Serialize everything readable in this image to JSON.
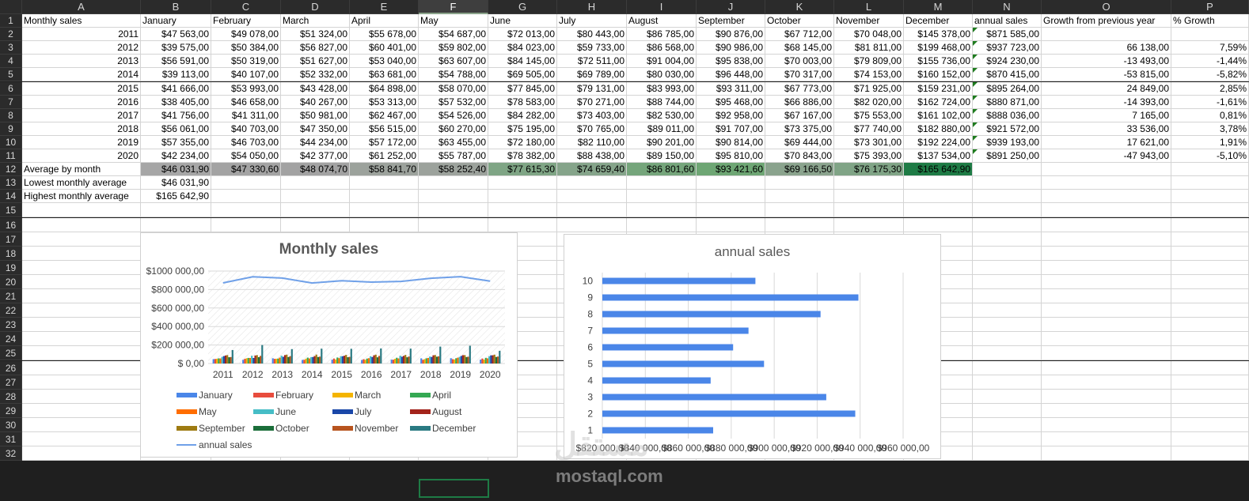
{
  "columns": [
    "A",
    "B",
    "C",
    "D",
    "E",
    "F",
    "G",
    "H",
    "I",
    "J",
    "K",
    "L",
    "M",
    "N",
    "O",
    "P"
  ],
  "selected_column": "F",
  "rows": [
    "1",
    "2",
    "3",
    "4",
    "5",
    "6",
    "7",
    "8",
    "9",
    "10",
    "11",
    "12",
    "13",
    "14",
    "15",
    "16",
    "17",
    "18",
    "19",
    "20",
    "21",
    "22",
    "23",
    "24",
    "25",
    "26",
    "27",
    "28",
    "29",
    "30",
    "31",
    "32"
  ],
  "header_row": [
    "Monthly sales",
    "January",
    "February",
    "March",
    "April",
    "May",
    "June",
    "July",
    "August",
    "September",
    "October",
    "November",
    "December",
    "annual sales",
    "Growth from previous year",
    "% Growth"
  ],
  "data_rows": [
    [
      "2011",
      "$47 563,00",
      "$49 078,00",
      "$51 324,00",
      "$55 678,00",
      "$54 687,00",
      "$72 013,00",
      "$80 443,00",
      "$86 785,00",
      "$90 876,00",
      "$67 712,00",
      "$70 048,00",
      "$145 378,00",
      "$871 585,00",
      "",
      ""
    ],
    [
      "2012",
      "$39 575,00",
      "$50 384,00",
      "$56 827,00",
      "$60 401,00",
      "$59 802,00",
      "$84 023,00",
      "$59 733,00",
      "$86 568,00",
      "$90 986,00",
      "$68 145,00",
      "$81 811,00",
      "$199 468,00",
      "$937 723,00",
      "66 138,00",
      "7,59%"
    ],
    [
      "2013",
      "$56 591,00",
      "$50 319,00",
      "$51 627,00",
      "$53 040,00",
      "$63 607,00",
      "$84 145,00",
      "$72 511,00",
      "$91 004,00",
      "$95 838,00",
      "$70 003,00",
      "$79 809,00",
      "$155 736,00",
      "$924 230,00",
      "-13 493,00",
      "-1,44%"
    ],
    [
      "2014",
      "$39 113,00",
      "$40 107,00",
      "$52 332,00",
      "$63 681,00",
      "$54 788,00",
      "$69 505,00",
      "$69 789,00",
      "$80 030,00",
      "$96 448,00",
      "$70 317,00",
      "$74 153,00",
      "$160 152,00",
      "$870 415,00",
      "-53 815,00",
      "-5,82%"
    ],
    [
      "2015",
      "$41 666,00",
      "$53 993,00",
      "$43 428,00",
      "$64 898,00",
      "$58 070,00",
      "$77 845,00",
      "$79 131,00",
      "$83 993,00",
      "$93 311,00",
      "$67 773,00",
      "$71 925,00",
      "$159 231,00",
      "$895 264,00",
      "24 849,00",
      "2,85%"
    ],
    [
      "2016",
      "$38 405,00",
      "$46 658,00",
      "$40 267,00",
      "$53 313,00",
      "$57 532,00",
      "$78 583,00",
      "$70 271,00",
      "$88 744,00",
      "$95 468,00",
      "$66 886,00",
      "$82 020,00",
      "$162 724,00",
      "$880 871,00",
      "-14 393,00",
      "-1,61%"
    ],
    [
      "2017",
      "$41 756,00",
      "$41 311,00",
      "$50 981,00",
      "$62 467,00",
      "$54 526,00",
      "$84 282,00",
      "$73 403,00",
      "$82 530,00",
      "$92 958,00",
      "$67 167,00",
      "$75 553,00",
      "$161 102,00",
      "$888 036,00",
      "7 165,00",
      "0,81%"
    ],
    [
      "2018",
      "$56 061,00",
      "$40 703,00",
      "$47 350,00",
      "$56 515,00",
      "$60 270,00",
      "$75 195,00",
      "$70 765,00",
      "$89 011,00",
      "$91 707,00",
      "$73 375,00",
      "$77 740,00",
      "$182 880,00",
      "$921 572,00",
      "33 536,00",
      "3,78%"
    ],
    [
      "2019",
      "$57 355,00",
      "$46 703,00",
      "$44 234,00",
      "$57 172,00",
      "$63 455,00",
      "$72 180,00",
      "$82 110,00",
      "$90 201,00",
      "$90 814,00",
      "$69 444,00",
      "$73 301,00",
      "$192 224,00",
      "$939 193,00",
      "17 621,00",
      "1,91%"
    ],
    [
      "2020",
      "$42 234,00",
      "$54 050,00",
      "$42 377,00",
      "$61 252,00",
      "$55 787,00",
      "$78 382,00",
      "$88 438,00",
      "$89 150,00",
      "$95 810,00",
      "$70 843,00",
      "$75 393,00",
      "$137 534,00",
      "$891 250,00",
      "-47 943,00",
      "-5,10%"
    ]
  ],
  "average_row": {
    "label": "Average by month",
    "values": [
      "$46 031,90",
      "$47 330,60",
      "$48 074,70",
      "$58 841,70",
      "$58 252,40",
      "$77 615,30",
      "$74 659,40",
      "$86 801,60",
      "$93 421,60",
      "$69 166,50",
      "$76 175,30",
      "$165 642,90"
    ],
    "fill_colors": [
      "#a6a6a6",
      "#a3a3a3",
      "#a2a2a2",
      "#9ca29c",
      "#9ca29c",
      "#7fa585",
      "#85a48a",
      "#75a57b",
      "#6ea674",
      "#8aa38d",
      "#80a486",
      "#1e7b45"
    ]
  },
  "lowest": {
    "label": "Lowest monthly average",
    "value": "$46 031,90"
  },
  "highest": {
    "label": "Highest monthly average",
    "value": "$165 642,90"
  },
  "chart_data": [
    {
      "type": "bar",
      "title": "Monthly sales",
      "categories": [
        "2011",
        "2012",
        "2013",
        "2014",
        "2015",
        "2016",
        "2017",
        "2018",
        "2019",
        "2020"
      ],
      "y_tick_labels": [
        "$1000 000,00",
        "$800 000,00",
        "$600 000,00",
        "$400 000,00",
        "$200 000,00",
        "$ 0,00"
      ],
      "ylim": [
        0,
        1000000
      ],
      "series": [
        {
          "name": "January",
          "color": "#4a86e8",
          "values": [
            47563,
            39575,
            56591,
            39113,
            41666,
            38405,
            41756,
            56061,
            57355,
            42234
          ]
        },
        {
          "name": "February",
          "color": "#e84c3d",
          "values": [
            49078,
            50384,
            50319,
            40107,
            53993,
            46658,
            41311,
            40703,
            46703,
            54050
          ]
        },
        {
          "name": "March",
          "color": "#f4b400",
          "values": [
            51324,
            56827,
            51627,
            52332,
            43428,
            40267,
            50981,
            47350,
            44234,
            42377
          ]
        },
        {
          "name": "April",
          "color": "#34a853",
          "values": [
            55678,
            60401,
            53040,
            63681,
            64898,
            53313,
            62467,
            56515,
            57172,
            61252
          ]
        },
        {
          "name": "May",
          "color": "#ff6d00",
          "values": [
            54687,
            59802,
            63607,
            54788,
            58070,
            57532,
            54526,
            60270,
            63455,
            55787
          ]
        },
        {
          "name": "June",
          "color": "#46bdc6",
          "values": [
            72013,
            84023,
            84145,
            69505,
            77845,
            78583,
            84282,
            75195,
            72180,
            78382
          ]
        },
        {
          "name": "July",
          "color": "#1a47a8",
          "values": [
            80443,
            59733,
            72511,
            69789,
            79131,
            70271,
            73403,
            70765,
            82110,
            88438
          ]
        },
        {
          "name": "August",
          "color": "#a3231b",
          "values": [
            86785,
            86568,
            91004,
            80030,
            83993,
            88744,
            82530,
            89011,
            90201,
            89150
          ]
        },
        {
          "name": "September",
          "color": "#9e7b12",
          "values": [
            90876,
            90986,
            95838,
            96448,
            93311,
            95468,
            92958,
            91707,
            90814,
            95810
          ]
        },
        {
          "name": "October",
          "color": "#1b6e3a",
          "values": [
            67712,
            68145,
            70003,
            70317,
            67773,
            66886,
            67167,
            73375,
            69444,
            70843
          ]
        },
        {
          "name": "November",
          "color": "#b8541f",
          "values": [
            70048,
            81811,
            79809,
            74153,
            71925,
            82020,
            75553,
            77740,
            73301,
            75393
          ]
        },
        {
          "name": "December",
          "color": "#2a7a82",
          "values": [
            145378,
            199468,
            155736,
            160152,
            159231,
            162724,
            161102,
            182880,
            192224,
            137534
          ]
        }
      ],
      "line_series": {
        "name": "annual sales",
        "color": "#6fa0e8",
        "values": [
          871585,
          937723,
          924230,
          870415,
          895264,
          880871,
          888036,
          921572,
          939193,
          891250
        ]
      },
      "legend_position": "bottom"
    },
    {
      "type": "bar",
      "orientation": "horizontal",
      "title": "annual sales",
      "categories": [
        "1",
        "2",
        "3",
        "4",
        "5",
        "6",
        "7",
        "8",
        "9",
        "10"
      ],
      "values": [
        871585,
        937723,
        924230,
        870415,
        895264,
        880871,
        888036,
        921572,
        939193,
        891250
      ],
      "xlim": [
        820000,
        960000
      ],
      "x_tick_labels": [
        "$820 000,00",
        "$840 000,00",
        "$860 000,00",
        "$880 000,00",
        "$900 000,00",
        "$920 000,00",
        "$940 000,00",
        "$960 000,00"
      ],
      "bar_color": "#4a86e8",
      "grid": true
    }
  ],
  "watermark": {
    "arabic": "مستقل",
    "latin": "mostaql.com"
  }
}
